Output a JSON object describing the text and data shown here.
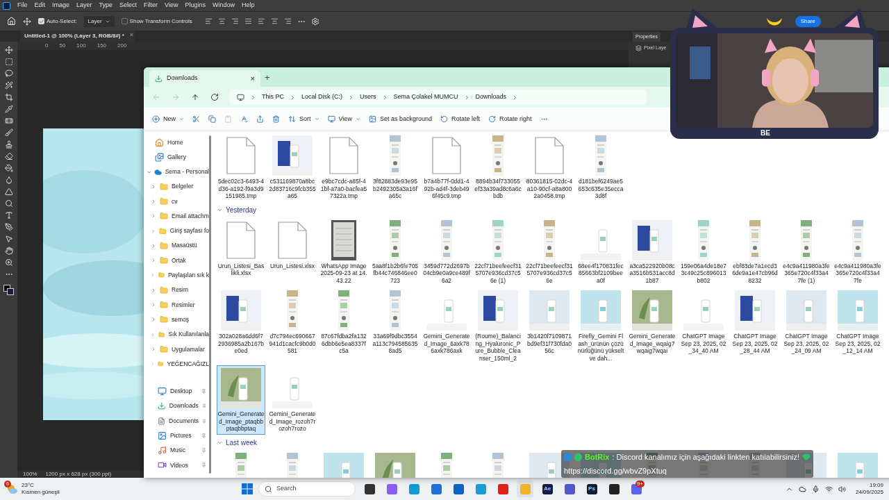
{
  "photoshop": {
    "menu": [
      "File",
      "Edit",
      "Image",
      "Layer",
      "Type",
      "Select",
      "Filter",
      "View",
      "Plugins",
      "Window",
      "Help"
    ],
    "options": {
      "auto_select": {
        "label": "Auto-Select:",
        "checked": true
      },
      "layer_dropdown": "Layer",
      "transform": {
        "label": "Show Transform Controls",
        "checked": false
      },
      "share": "Share"
    },
    "document_tab": {
      "title": "Untitled-1 @ 100% (Layer 3, RGB/8#) *",
      "close": "×"
    },
    "ruler": [
      "0",
      "50",
      "100",
      "150",
      "200"
    ],
    "panel": {
      "tab": "Properties",
      "row": "Pixel Laye"
    },
    "status": {
      "zoom": "100%",
      "size": "1200 px x 628 px (300 ppi)"
    }
  },
  "explorer": {
    "tab": {
      "title": "Downloads",
      "close": "×",
      "new": "+"
    },
    "nav_buttons": [
      {
        "kind": "back",
        "disabled": true
      },
      {
        "kind": "forward",
        "disabled": true
      },
      {
        "kind": "up",
        "disabled": false
      },
      {
        "kind": "refresh",
        "disabled": false
      }
    ],
    "breadcrumb": [
      "This PC",
      "Local Disk (C:)",
      "Users",
      "Sema Çolakel MUMCU",
      "Downloads"
    ],
    "commands": [
      {
        "kind": "new",
        "label": "New",
        "disabled": false
      },
      {
        "kind": "cut",
        "disabled": false
      },
      {
        "kind": "copy",
        "disabled": false
      },
      {
        "kind": "paste",
        "disabled": true
      },
      {
        "kind": "rename",
        "disabled": false
      },
      {
        "kind": "share",
        "disabled": false
      },
      {
        "kind": "delete",
        "disabled": false
      },
      {
        "kind": "sort",
        "label": "Sort",
        "disabled": false
      },
      {
        "kind": "view",
        "label": "View",
        "disabled": false
      },
      {
        "kind": "background",
        "label": "Set as background",
        "disabled": false
      },
      {
        "kind": "rotate-left",
        "label": "Rotate left",
        "disabled": false
      },
      {
        "kind": "rotate-right",
        "label": "Rotate right",
        "disabled": false
      },
      {
        "kind": "more",
        "disabled": false
      }
    ],
    "sidebar": {
      "top": [
        {
          "kind": "home",
          "label": "Home"
        },
        {
          "kind": "gallery",
          "label": "Gallery"
        }
      ],
      "tree": {
        "label": "Sema - Personal",
        "expanded": true,
        "children": [
          {
            "label": "Belgeler",
            "expanded": false
          },
          {
            "label": "cv",
            "expanded": false
          },
          {
            "label": "Email attachm",
            "expanded": false
          },
          {
            "label": "Giriş sayfası fo",
            "expanded": false
          },
          {
            "label": "Masaüstü",
            "expanded": false
          },
          {
            "label": "Ortak",
            "expanded": false
          },
          {
            "label": "Paylaşılan sık k",
            "expanded": false
          },
          {
            "label": "Resim",
            "expanded": false
          },
          {
            "label": "Resimler",
            "expanded": false
          },
          {
            "label": "semoş",
            "expanded": false
          },
          {
            "label": "Sık Kullanılanla",
            "expanded": false
          },
          {
            "label": "Uygulamalar",
            "expanded": false
          },
          {
            "label": "YEĞENCAĞIZL",
            "expanded": false
          }
        ]
      },
      "pinned": [
        {
          "kind": "desktop",
          "label": "Desktop"
        },
        {
          "kind": "downloads",
          "label": "Downloads"
        },
        {
          "kind": "documents",
          "label": "Documents"
        },
        {
          "kind": "pictures",
          "label": "Pictures"
        },
        {
          "kind": "music",
          "label": "Music"
        },
        {
          "kind": "videos",
          "label": "Videos"
        }
      ]
    },
    "groups": [
      {
        "items": [
          {
            "kind": "file",
            "name": "5dec02c3-6493-4d36-a192-f9a3d9151985.tmp",
            "selected": false
          },
          {
            "kind": "product",
            "name": "c531169870a8bc2d83716c9fcb355a65",
            "selected": false
          },
          {
            "kind": "file",
            "name": "e9bc7cdc-a85f-41bf-a7a0-bacfea57322a.tmp",
            "selected": false
          },
          {
            "kind": "strip",
            "name": "3f82883de93e95b2492305a3a16fa65c",
            "selected": false
          },
          {
            "kind": "file",
            "name": "b7a4b77f-0dd1-492b-ad4f-3deb496f45c9.tmp",
            "selected": false
          },
          {
            "kind": "strip",
            "name": "8894b34f733055ef33a39ad8c6a6cbdb",
            "selected": false
          },
          {
            "kind": "file",
            "name": "80361815-02dc-4a10-90cf-a8a8002a0458.tmp",
            "selected": false
          },
          {
            "kind": "strip",
            "name": "d181bef6249ae5653c635e35ecca3d8f",
            "selected": false
          }
        ]
      },
      {
        "label": "Yesterday",
        "expanded": true,
        "items": [
          {
            "kind": "file",
            "name": "Urun_Listesi_Baslikli.xlsx",
            "selected": false
          },
          {
            "kind": "file",
            "name": "Urun_Listesi.xlsx",
            "selected": false
          },
          {
            "kind": "scan",
            "name": "WhatsApp Image 2025-09-23 at 14.43.22",
            "selected": false
          },
          {
            "kind": "strip",
            "name": "5aa8f1b2b6fe705fb44c746846ee0723",
            "selected": false
          },
          {
            "kind": "strip",
            "name": "3459d772d2697b04cb9e0a9ce489f6a2",
            "selected": false
          },
          {
            "kind": "strip",
            "name": "22cf71beefeecf315707e936cd37c56e (1)",
            "selected": false
          },
          {
            "kind": "strip",
            "name": "22cf71beefeecf315707e936cd37c56e",
            "selected": false
          },
          {
            "kind": "product",
            "name": "68ee4f170831fec85663bf2109beea0f",
            "selected": false
          },
          {
            "kind": "product",
            "name": "a3ca522920b08ca3516b531acc8d1b87",
            "selected": false
          },
          {
            "kind": "strip",
            "name": "159e06a4de18e73c49c25c896013b802",
            "selected": false
          },
          {
            "kind": "strip",
            "name": "ebf83de7a1ecd36de9a1e47cb96d8232",
            "selected": false
          },
          {
            "kind": "strip",
            "name": "e4c9a411980a3fe365e720c4f33a47fe (1)",
            "selected": false
          },
          {
            "kind": "strip",
            "name": "e4c9a411980a3fe365e720c4f33a47fe",
            "selected": false
          },
          {
            "kind": "product",
            "name": "302a028a6dd6f72936985a2b167be0ed",
            "selected": false
          },
          {
            "kind": "strip",
            "name": "d7c794ec690667941d1cacfc9b0d0581",
            "selected": false
          },
          {
            "kind": "strip",
            "name": "87c67fdba2fa1326dbb6e5ea8337fc5a",
            "selected": false
          },
          {
            "kind": "strip",
            "name": "33a69f9dbc3554a113c7945856358ad5",
            "selected": false
          },
          {
            "kind": "product",
            "name": "Gemini_Generated_Image_6axk786axk786axk",
            "selected": false
          },
          {
            "kind": "product",
            "name": "(Roume)_Balancing_Hyaluronic_Pure_Bubble_Cleanser_150ml_2",
            "selected": false
          },
          {
            "kind": "product",
            "name": "3b1420f7109871bd9ef31f730fda056c",
            "selected": false
          },
          {
            "kind": "product",
            "name": "Firefly_Gemini Flash_ürünün çözünürlüğünü yükselt ve dah...",
            "selected": false
          },
          {
            "kind": "product",
            "name": "Gemini_Generated_Image_wqaig7wqaig7wqai",
            "selected": false
          },
          {
            "kind": "product",
            "name": "ChatGPT Image Sep 23, 2025, 02_34_40 AM",
            "selected": false
          },
          {
            "kind": "product",
            "name": "ChatGPT Image Sep 23, 2025, 02_28_44 AM",
            "selected": false
          },
          {
            "kind": "product",
            "name": "ChatGPT Image Sep 23, 2025, 02_24_09 AM",
            "selected": false
          },
          {
            "kind": "product",
            "name": "ChatGPT Image Sep 23, 2025, 02_12_14 AM",
            "selected": false
          },
          {
            "kind": "product",
            "name": "Gemini_Generated_Image_ptaqbbptaqbbptaq",
            "selected": true
          },
          {
            "kind": "product",
            "name": "Gemini_Generated_Image_rozoh7rozoh7rozo",
            "selected": false
          }
        ]
      },
      {
        "label": "Last week",
        "expanded": true,
        "items": [
          {
            "kind": "strip"
          },
          {
            "kind": "strip"
          },
          {
            "kind": "product"
          },
          {
            "kind": "product"
          },
          {
            "kind": "strip"
          },
          {
            "kind": "strip"
          },
          {
            "kind": "product"
          },
          {
            "kind": "product"
          },
          {
            "kind": "strip"
          },
          {
            "kind": "strip"
          },
          {
            "kind": "strip"
          },
          {
            "kind": "product"
          },
          {
            "kind": "product"
          }
        ]
      }
    ]
  },
  "webcam": {
    "label": "BE"
  },
  "chat": {
    "user": "BotRix",
    "message": ": Discord kanalımız için aşağıdaki linkten katılabilirsiniz!",
    "link": "https://discord.gg/wbvZ9pXtuq"
  },
  "taskbar": {
    "weather": {
      "badge": "6",
      "temp": "23°C",
      "condition": "Kısmen güneşli"
    },
    "search": "Search",
    "apps": [
      {
        "kind": "taskview",
        "selected": false
      },
      {
        "kind": "copilot",
        "selected": false
      },
      {
        "kind": "edge",
        "selected": false
      },
      {
        "kind": "store",
        "selected": false
      },
      {
        "kind": "outlook",
        "selected": false
      },
      {
        "kind": "desktop",
        "selected": false
      },
      {
        "kind": "opera",
        "selected": false
      },
      {
        "kind": "explorer",
        "selected": true
      },
      {
        "kind": "ae",
        "label": "Ae",
        "selected": false
      },
      {
        "kind": "teams",
        "selected": false
      },
      {
        "kind": "ps",
        "label": "Ps",
        "selected": false
      },
      {
        "kind": "github",
        "selected": false
      },
      {
        "kind": "discord",
        "badge": "9+",
        "selected": false
      }
    ],
    "time": "19:09",
    "date": "24/09/2025"
  }
}
